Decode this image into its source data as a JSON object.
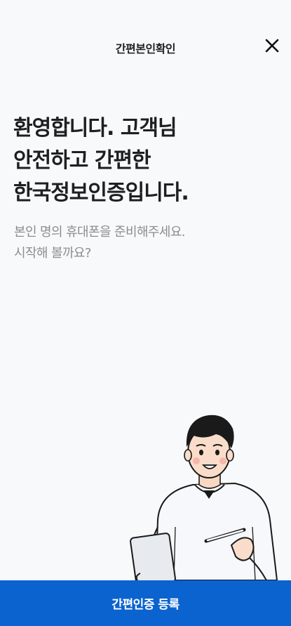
{
  "header": {
    "title": "간편본인확인",
    "close_icon": "close-icon"
  },
  "headline": {
    "lines": [
      "환영합니다. 고객님",
      "안전하고 간편한",
      "한국정보인증입니다."
    ]
  },
  "subtext": {
    "lines": [
      "본인 명의 휴대폰을 준비해주세요.",
      "시작해 볼까요?"
    ]
  },
  "illustration": {
    "icon": "man-holding-phone-and-pen-illustration"
  },
  "cta": {
    "label": "간편인증 등록",
    "color": "#0b63cf"
  }
}
